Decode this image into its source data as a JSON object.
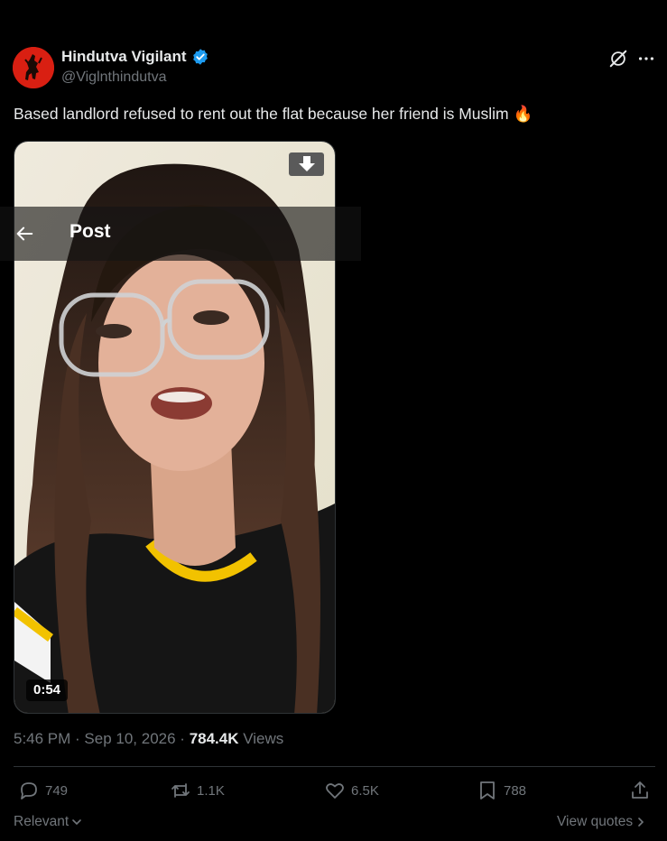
{
  "author": {
    "name": "Hindutva Vigilant",
    "handle": "@Viglnthindutva",
    "verified": true,
    "verified_color": "#1d9bf0"
  },
  "tweet": {
    "text": "Based landlord refused to rent out the flat because her friend is Muslim",
    "emoji": "🔥"
  },
  "media": {
    "duration": "0:54",
    "download_icon": "download-arrow-icon"
  },
  "nav": {
    "title": "Post",
    "back_icon": "back-arrow-icon"
  },
  "meta": {
    "time": "5:46 PM",
    "sep1": " · ",
    "date": "Sep 10, 2026",
    "sep2": " · ",
    "views_count": "784.4K",
    "views_label": " Views"
  },
  "actions": {
    "replies": "749",
    "reposts": "1.1K",
    "likes": "6.5K",
    "bookmarks": "788"
  },
  "footer": {
    "sort_label": "Relevant",
    "view_quotes": "View quotes"
  },
  "colors": {
    "background": "#000000",
    "text_primary": "#e7e9ea",
    "text_secondary": "#71767b",
    "divider": "#2f3336",
    "avatar_bg": "#d91f12"
  }
}
